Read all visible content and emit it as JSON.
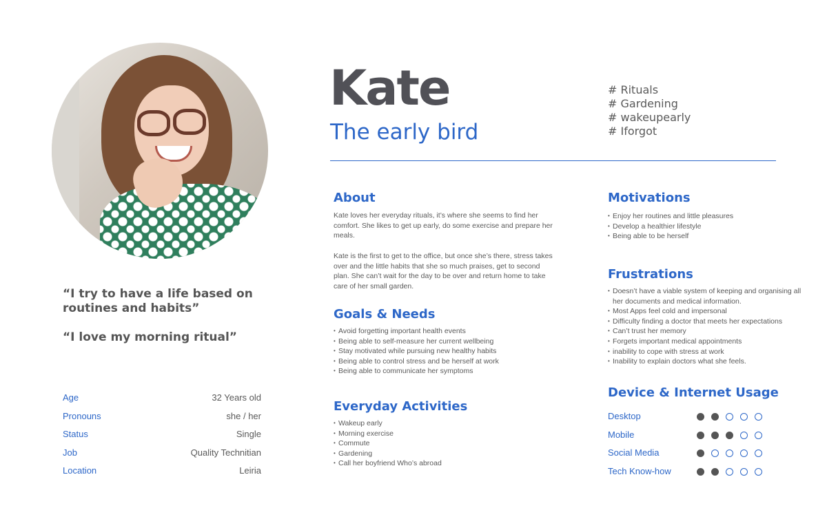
{
  "persona": {
    "name": "Kate",
    "subtitle": "The early bird",
    "tags": [
      "# Rituals",
      "# Gardening",
      "# wakeupearly",
      "# Iforgot"
    ]
  },
  "quotes": [
    "“I try to have a life based on routines and habits”",
    "“I love my morning ritual”"
  ],
  "info": [
    {
      "label": "Age",
      "value": "32 Years old"
    },
    {
      "label": "Pronouns",
      "value": "she / her"
    },
    {
      "label": "Status",
      "value": "Single"
    },
    {
      "label": "Job",
      "value": "Quality Technitian"
    },
    {
      "label": "Location",
      "value": "Leiria"
    }
  ],
  "about": {
    "title": "About",
    "p1": "Kate loves her everyday rituals, it’s where she seems to find her comfort. She likes to get up early, do some exercise and prepare her meals.",
    "p2": "Kate is the first to get to the office, but once she’s there, stress takes over and the little habits that she so much praises, get to second plan. She can’t wait for the day to be over and return home to take care of her small garden."
  },
  "goals": {
    "title": "Goals & Needs",
    "items": [
      "Avoid forgetting important health events",
      "Being able to self-measure her current wellbeing",
      "Stay motivated while pursuing new healthy habits",
      "Being able to control stress and be herself at work",
      "Being able to communicate her symptoms"
    ]
  },
  "activities": {
    "title": "Everyday Activities",
    "items": [
      "Wakeup early",
      "Morning exercise",
      "Commute",
      "Gardening",
      "Call her boyfriend Who’s abroad"
    ]
  },
  "motivations": {
    "title": "Motivations",
    "items": [
      "Enjoy her routines and little pleasures",
      "Develop a healthier lifestyle",
      "Being able to be herself"
    ]
  },
  "frustrations": {
    "title": "Frustrations",
    "items": [
      "Doesn’t have a viable system of keeping and organising all her documents and medical information.",
      "Most Apps feel cold and impersonal",
      "Difficulty finding a doctor that meets her expectations",
      "Can’t trust her memory",
      "Forgets important medical appointments",
      "inability to cope with stress at work",
      "Inability to explain doctors what she feels."
    ]
  },
  "device_usage": {
    "title": "Device & Internet Usage",
    "max": 5,
    "rows": [
      {
        "label": "Desktop",
        "level": 2
      },
      {
        "label": "Mobile",
        "level": 3
      },
      {
        "label": "Social Media",
        "level": 1
      },
      {
        "label": "Tech Know-how",
        "level": 2
      }
    ]
  },
  "colors": {
    "accent": "#2d67c8",
    "text": "#595959",
    "name": "#515157",
    "dot_filled": "#555555"
  }
}
